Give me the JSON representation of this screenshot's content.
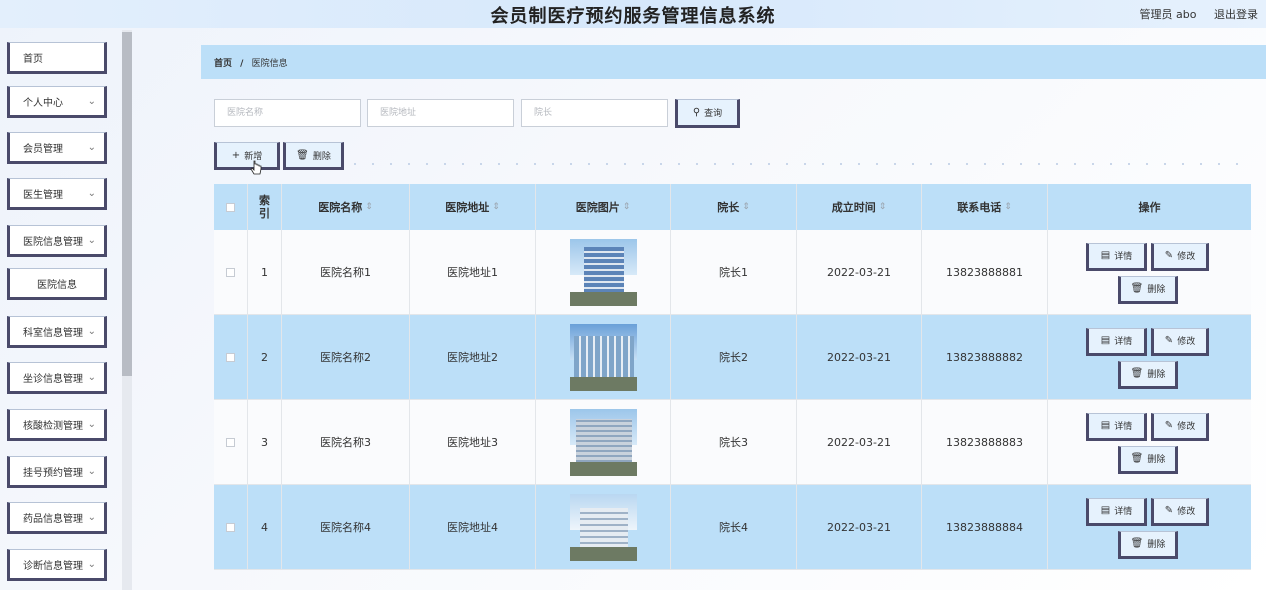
{
  "header": {
    "title": "会员制医疗预约服务管理信息系统",
    "user": "管理员 abo",
    "logout": "退出登录"
  },
  "sidebar": {
    "items": [
      {
        "label": "首页",
        "has_chevron": false
      },
      {
        "label": "个人中心",
        "has_chevron": true
      },
      {
        "label": "会员管理",
        "has_chevron": true
      },
      {
        "label": "医生管理",
        "has_chevron": true
      },
      {
        "label": "医院信息管理",
        "has_chevron": true
      },
      {
        "label": "医院信息",
        "has_chevron": false,
        "sub": true
      },
      {
        "label": "科室信息管理",
        "has_chevron": true
      },
      {
        "label": "坐诊信息管理",
        "has_chevron": true
      },
      {
        "label": "核酸检测管理",
        "has_chevron": true
      },
      {
        "label": "挂号预约管理",
        "has_chevron": true
      },
      {
        "label": "药品信息管理",
        "has_chevron": true
      },
      {
        "label": "诊断信息管理",
        "has_chevron": true
      }
    ]
  },
  "breadcrumb": {
    "home": "首页",
    "sep": "/",
    "current": "医院信息"
  },
  "search": {
    "name_placeholder": "医院名称",
    "address_placeholder": "医院地址",
    "dean_placeholder": "院长",
    "button": "查询"
  },
  "toolbar": {
    "add": "新增",
    "delete": "删除"
  },
  "table": {
    "headers": {
      "index": "索引",
      "name": "医院名称",
      "address": "医院地址",
      "image": "医院图片",
      "dean": "院长",
      "date": "成立时间",
      "phone": "联系电话",
      "ops": "操作"
    },
    "rows": [
      {
        "index": "1",
        "name": "医院名称1",
        "address": "医院地址1",
        "dean": "院长1",
        "date": "2022-03-21",
        "phone": "13823888881"
      },
      {
        "index": "2",
        "name": "医院名称2",
        "address": "医院地址2",
        "dean": "院长2",
        "date": "2022-03-21",
        "phone": "13823888882"
      },
      {
        "index": "3",
        "name": "医院名称3",
        "address": "医院地址3",
        "dean": "院长3",
        "date": "2022-03-21",
        "phone": "13823888883"
      },
      {
        "index": "4",
        "name": "医院名称4",
        "address": "医院地址4",
        "dean": "院长4",
        "date": "2022-03-21",
        "phone": "13823888884"
      }
    ],
    "actions": {
      "detail": "详情",
      "edit": "修改",
      "delete": "删除"
    }
  },
  "colors": {
    "accent": "#bcdff8",
    "border_dark": "#4a4a6a"
  }
}
